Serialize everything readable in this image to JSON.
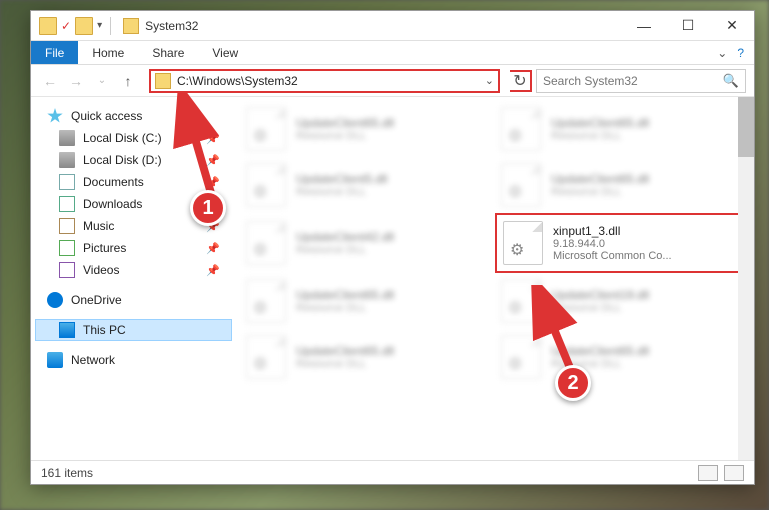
{
  "window": {
    "title": "System32",
    "ribbon_tabs": {
      "file": "File",
      "home": "Home",
      "share": "Share",
      "view": "View"
    }
  },
  "nav": {
    "address": "C:\\Windows\\System32",
    "search_placeholder": "Search System32"
  },
  "sidebar": {
    "quick_access": "Quick access",
    "items": [
      {
        "label": "Local Disk (C:)"
      },
      {
        "label": "Local Disk (D:)"
      },
      {
        "label": "Documents"
      },
      {
        "label": "Downloads"
      },
      {
        "label": "Music"
      },
      {
        "label": "Pictures"
      },
      {
        "label": "Videos"
      }
    ],
    "onedrive": "OneDrive",
    "thispc": "This PC",
    "network": "Network"
  },
  "files": {
    "blurred": [
      {
        "name": "UpdateClient65.dll",
        "sub": "Resource DLL"
      },
      {
        "name": "UpdateClient65.dll",
        "sub": "Resource DLL"
      },
      {
        "name": "UpdateClient5.dll",
        "sub": "Resource DLL"
      },
      {
        "name": "UpdateClient65.dll",
        "sub": "Resource DLL"
      },
      {
        "name": "UpdateClient42.dll",
        "sub": "Resource DLL"
      }
    ],
    "highlighted": {
      "name": "xinput1_3.dll",
      "version": "9.18.944.0",
      "desc": "Microsoft Common Co..."
    },
    "blurred2": [
      {
        "name": "UpdateClient65.dll",
        "sub": "Resource DLL"
      },
      {
        "name": "UpdateClient19.dll",
        "sub": "Resource DLL"
      },
      {
        "name": "UpdateClient65.dll",
        "sub": "Resource DLL"
      },
      {
        "name": "UpdateClient65.dll",
        "sub": "Resource DLL"
      }
    ]
  },
  "status": {
    "count": "161 items"
  },
  "annotations": {
    "badge1": "1",
    "badge2": "2"
  }
}
